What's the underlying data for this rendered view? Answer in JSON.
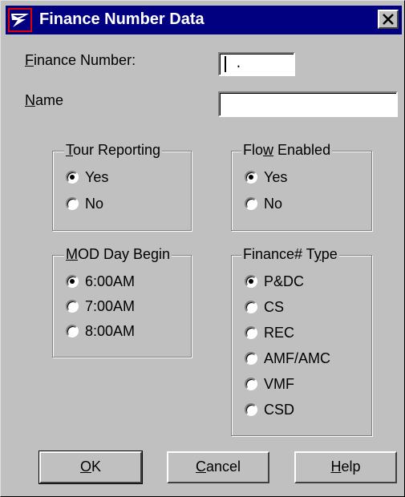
{
  "window": {
    "title": "Finance Number Data",
    "close_glyph": "✕"
  },
  "fields": {
    "finance_number_label_rest": "inance Number:",
    "finance_number_label_first": "F",
    "finance_number_mask": " .    ",
    "name_label_first": "N",
    "name_label_rest": "ame",
    "name_value": ""
  },
  "groups": {
    "tour_reporting": {
      "legend_first": "T",
      "legend_rest": "our Reporting",
      "options": [
        {
          "label": "Yes",
          "checked": true
        },
        {
          "label": "No",
          "checked": false
        }
      ]
    },
    "flow_enabled": {
      "legend_pre": "Flo",
      "legend_under": "w",
      "legend_post": " Enabled",
      "options": [
        {
          "label": "Yes",
          "checked": true
        },
        {
          "label": "No",
          "checked": false
        }
      ]
    },
    "mod_day_begin": {
      "legend_first": "M",
      "legend_rest": "OD Day Begin",
      "options": [
        {
          "label": "6:00AM",
          "checked": true
        },
        {
          "label": "7:00AM",
          "checked": false
        },
        {
          "label": "8:00AM",
          "checked": false
        }
      ]
    },
    "finance_type": {
      "legend_pre": "Finance# T",
      "legend_under": "y",
      "legend_post": "pe",
      "options": [
        {
          "label": "P&DC",
          "checked": true
        },
        {
          "label": "CS",
          "checked": false
        },
        {
          "label": "REC",
          "checked": false
        },
        {
          "label": "AMF/AMC",
          "checked": false
        },
        {
          "label": "VMF",
          "checked": false
        },
        {
          "label": "CSD",
          "checked": false
        }
      ]
    }
  },
  "buttons": {
    "ok_first": "O",
    "ok_rest": "K",
    "cancel_first": "C",
    "cancel_rest": "ancel",
    "help_first": "H",
    "help_rest": "elp"
  }
}
